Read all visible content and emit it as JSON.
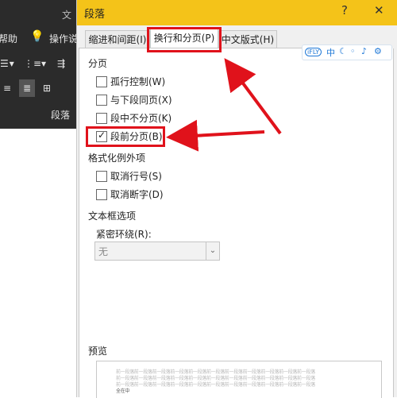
{
  "ribbon": {
    "tab_partial_left": "帮助",
    "tab_partial_tell": "操作说",
    "doc_title_partial": "文",
    "group_label": "段落"
  },
  "dialog": {
    "title": "段落",
    "help_label": "?",
    "close_label": "✕"
  },
  "tabs": [
    {
      "label": "缩进和间距(I)",
      "active": false
    },
    {
      "label": "换行和分页(P)",
      "active": true
    },
    {
      "label": "中文版式(H)",
      "active": false
    }
  ],
  "ifly_toolbar": {
    "logo": "iFLY",
    "items": [
      "中",
      "☾",
      "◦",
      "♪",
      "⚙"
    ]
  },
  "pagination": {
    "heading": "分页",
    "options": [
      {
        "label": "孤行控制(W)",
        "checked": false
      },
      {
        "label": "与下段同页(X)",
        "checked": false
      },
      {
        "label": "段中不分页(K)",
        "checked": false
      },
      {
        "label": "段前分页(B)",
        "checked": true
      }
    ]
  },
  "format_exceptions": {
    "heading": "格式化例外项",
    "options": [
      {
        "label": "取消行号(S)",
        "checked": false
      },
      {
        "label": "取消断字(D)",
        "checked": false
      }
    ]
  },
  "textbox_options": {
    "heading": "文本框选项",
    "tight_wrap_label": "紧密环绕(R):",
    "tight_wrap_value": "无"
  },
  "preview": {
    "heading": "预览",
    "filler_line": "前一段落前一段落前一段落前一段落前一段落前一段落前一段落前一段落前一段落前一段落前一段落",
    "short_line": "全在中"
  },
  "colors": {
    "titlebar": "#f4c319",
    "annotation_red": "#e0121b",
    "ribbon_dark": "#2b2b2b"
  }
}
